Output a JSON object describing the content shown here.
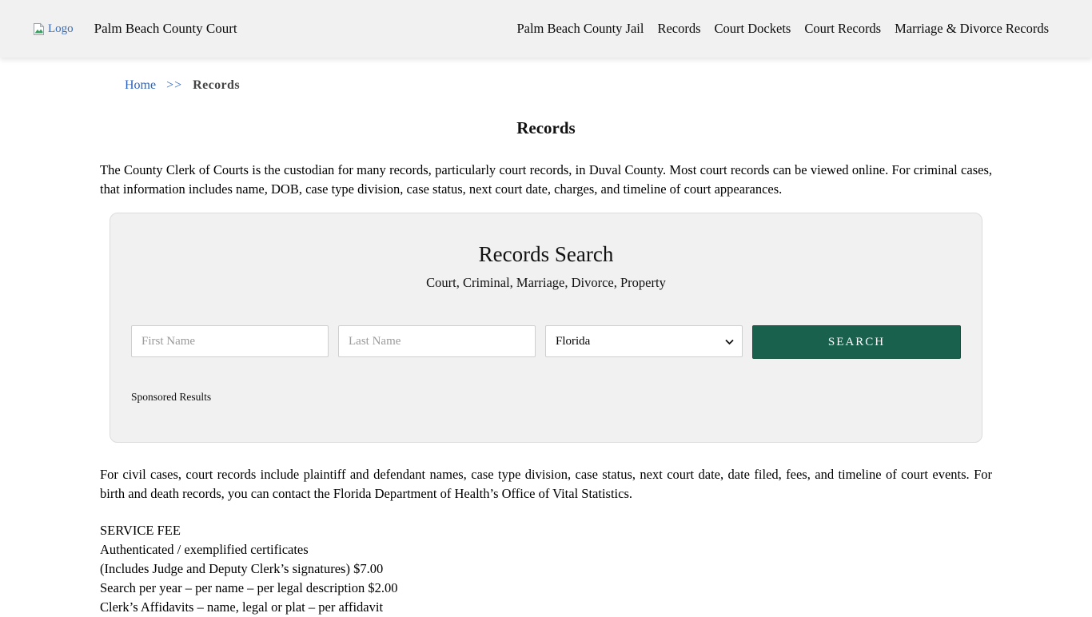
{
  "header": {
    "logo_alt": "Logo",
    "site_title": "Palm Beach County Court",
    "nav": [
      {
        "label": "Palm Beach County Jail"
      },
      {
        "label": "Records"
      },
      {
        "label": "Court Dockets"
      },
      {
        "label": "Court Records"
      },
      {
        "label": "Marriage & Divorce Records"
      }
    ]
  },
  "breadcrumb": {
    "home_label": "Home",
    "separator": ">>",
    "current": "Records"
  },
  "page": {
    "title": "Records",
    "intro_text": "The County Clerk of Courts is the custodian for many records, particularly court records, in Duval County. Most court records can be viewed online. For criminal cases, that information includes name, DOB, case type division, case status, next court date, charges, and timeline of court appearances.",
    "civil_text": "For civil cases, court records include plaintiff and defendant names, case type division, case status, next court date, date filed, fees, and timeline of court events. For birth and death records, you can contact the Florida Department of Health’s Office of Vital Statistics."
  },
  "search_panel": {
    "title": "Records Search",
    "subtitle": "Court, Criminal, Marriage, Divorce, Property",
    "first_name_placeholder": "First Name",
    "last_name_placeholder": "Last Name",
    "state_selected": "Florida",
    "search_button_label": "SEARCH",
    "sponsored_label": "Sponsored Results"
  },
  "service_fees": {
    "heading": "SERVICE FEE",
    "lines": [
      "Authenticated / exemplified certificates",
      "(Includes Judge and Deputy Clerk’s signatures) $7.00",
      "Search per year – per name – per legal description $2.00",
      "Clerk’s Affidavits – name, legal or plat – per affidavit"
    ]
  },
  "colors": {
    "header_bg": "#f1f1f1",
    "panel_bg": "#f1f1f1",
    "accent_green": "#1a614d",
    "link_blue": "#2c63c0",
    "logo_text_blue": "#3b6cb5"
  }
}
